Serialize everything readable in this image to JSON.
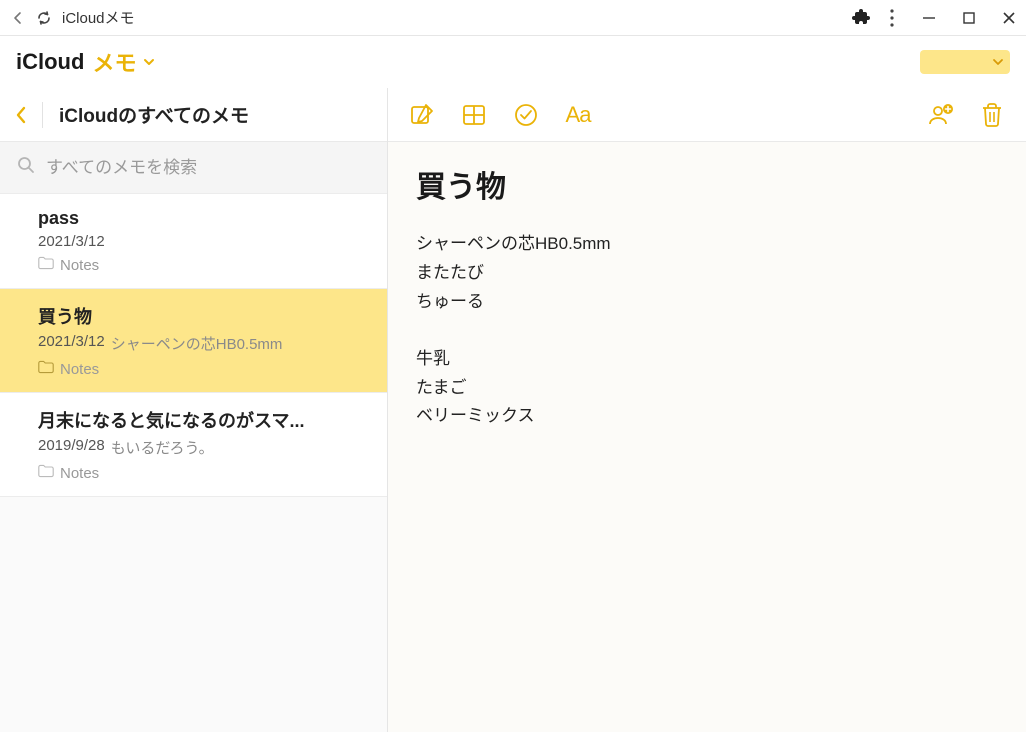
{
  "chrome": {
    "page_title": "iCloudメモ"
  },
  "header": {
    "brand_icloud": "iCloud",
    "brand_memo": "メモ"
  },
  "sidebar": {
    "title": "iCloudのすべてのメモ",
    "search_placeholder": "すべてのメモを検索",
    "folder_label": "Notes",
    "notes": [
      {
        "title": "pass",
        "date": "2021/3/12",
        "preview": "",
        "folder": "Notes",
        "selected": false
      },
      {
        "title": "買う物",
        "date": "2021/3/12",
        "preview": "シャーペンの芯HB0.5mm",
        "folder": "Notes",
        "selected": true
      },
      {
        "title": "月末になると気になるのがスマ...",
        "date": "2019/9/28",
        "preview": "もいるだろう。",
        "folder": "Notes",
        "selected": false
      }
    ]
  },
  "document": {
    "title": "買う物",
    "lines": [
      "シャーペンの芯HB0.5mm",
      "またたび",
      "ちゅーる",
      "",
      "牛乳",
      "たまご",
      "ベリーミックス"
    ]
  },
  "colors": {
    "accent": "#eab308"
  }
}
